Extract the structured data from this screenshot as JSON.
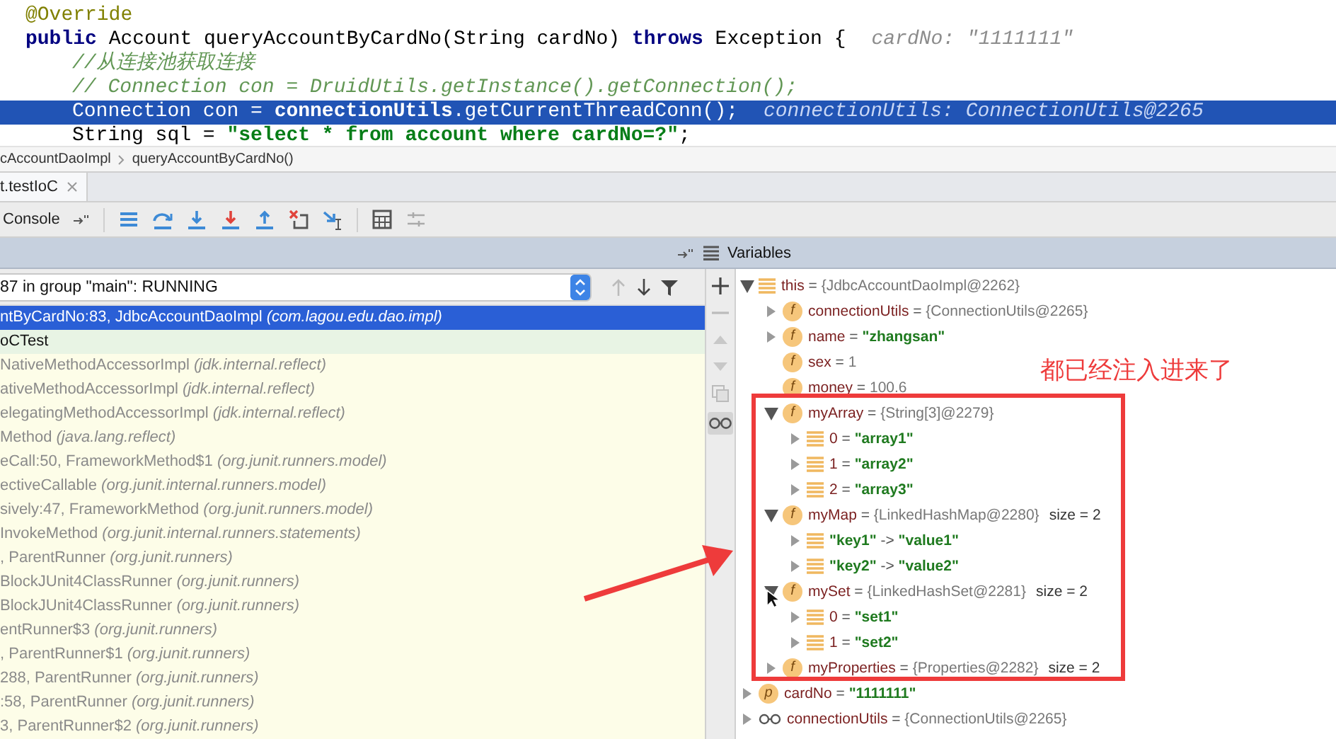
{
  "editor": {
    "lines": [
      {
        "indented": false,
        "selected": false,
        "tokens": [
          {
            "kind": "annotation",
            "text": "@Override"
          }
        ]
      },
      {
        "indented": false,
        "selected": false,
        "tokens": [
          {
            "kind": "keyword",
            "text": "public"
          },
          {
            "kind": "plain",
            "text": " Account queryAccountByCardNo(String cardNo) "
          },
          {
            "kind": "keyword",
            "text": "throws"
          },
          {
            "kind": "plain",
            "text": " Exception {"
          }
        ],
        "hint": "cardNo: \"1111111\""
      },
      {
        "indented": true,
        "selected": false,
        "tokens": [
          {
            "kind": "comment",
            "text": "//从连接池获取连接"
          }
        ]
      },
      {
        "indented": true,
        "selected": false,
        "tokens": [
          {
            "kind": "comment",
            "text": "// Connection con = DruidUtils.getInstance().getConnection();"
          }
        ]
      },
      {
        "indented": true,
        "selected": true,
        "tokens": [
          {
            "kind": "plain",
            "text": "Connection con = "
          },
          {
            "kind": "field",
            "text": "connectionUtils"
          },
          {
            "kind": "plain",
            "text": ".getCurrentThreadConn();"
          }
        ],
        "hint": "connectionUtils: ConnectionUtils@2265"
      },
      {
        "indented": true,
        "selected": false,
        "tokens": [
          {
            "kind": "plain",
            "text": "String sql = "
          },
          {
            "kind": "string",
            "text": "\"select * from account where cardNo=?\""
          },
          {
            "kind": "plain",
            "text": ";"
          }
        ]
      }
    ]
  },
  "breadcrumb": [
    "cAccountDaoImpl",
    "queryAccountByCardNo()"
  ],
  "tabs": [
    {
      "label": "t.testIoC",
      "selected": true
    }
  ],
  "console_tab": "Console",
  "variables_header": "Variables",
  "thread": {
    "value": "87 in group \"main\": RUNNING"
  },
  "frames": [
    {
      "method": "ntByCardNo:83, JdbcAccountDaoImpl ",
      "package": "(com.lagou.edu.dao.impl)",
      "selected": true,
      "kind": "project"
    },
    {
      "method": "oCTest",
      "selected": false,
      "kind": "project"
    },
    {
      "method": "NativeMethodAccessorImpl ",
      "package": "(jdk.internal.reflect)",
      "selected": false,
      "kind": "library"
    },
    {
      "method": "ativeMethodAccessorImpl ",
      "package": "(jdk.internal.reflect)",
      "selected": false,
      "kind": "library"
    },
    {
      "method": "elegatingMethodAccessorImpl ",
      "package": "(jdk.internal.reflect)",
      "selected": false,
      "kind": "library"
    },
    {
      "method": "Method ",
      "package": "(java.lang.reflect)",
      "selected": false,
      "kind": "library"
    },
    {
      "method": "eCall:50, FrameworkMethod$1 ",
      "package": "(org.junit.runners.model)",
      "selected": false,
      "kind": "library"
    },
    {
      "method": "ectiveCallable ",
      "package": "(org.junit.internal.runners.model)",
      "selected": false,
      "kind": "library"
    },
    {
      "method": "sively:47, FrameworkMethod ",
      "package": "(org.junit.runners.model)",
      "selected": false,
      "kind": "library"
    },
    {
      "method": "InvokeMethod ",
      "package": "(org.junit.internal.runners.statements)",
      "selected": false,
      "kind": "library"
    },
    {
      "method": ", ParentRunner ",
      "package": "(org.junit.runners)",
      "selected": false,
      "kind": "library"
    },
    {
      "method": "BlockJUnit4ClassRunner ",
      "package": "(org.junit.runners)",
      "selected": false,
      "kind": "library"
    },
    {
      "method": "BlockJUnit4ClassRunner ",
      "package": "(org.junit.runners)",
      "selected": false,
      "kind": "library"
    },
    {
      "method": "entRunner$3 ",
      "package": "(org.junit.runners)",
      "selected": false,
      "kind": "library"
    },
    {
      "method": ", ParentRunner$1 ",
      "package": "(org.junit.runners)",
      "selected": false,
      "kind": "library"
    },
    {
      "method": "288, ParentRunner ",
      "package": "(org.junit.runners)",
      "selected": false,
      "kind": "library"
    },
    {
      "method": ":58, ParentRunner ",
      "package": "(org.junit.runners)",
      "selected": false,
      "kind": "library"
    },
    {
      "method": "3, ParentRunner$2 ",
      "package": "(org.junit.runners)",
      "selected": false,
      "kind": "library"
    }
  ],
  "variables": [
    {
      "kind": "object",
      "name": "this",
      "separator": " = ",
      "value": "{JdbcAccountDaoImpl@2262}",
      "expandable": true,
      "expanded": true,
      "children": [
        {
          "kind": "field",
          "badge": "f",
          "name": "connectionUtils",
          "separator": " = ",
          "value": "{ConnectionUtils@2265}",
          "expandable": true,
          "expanded": false
        },
        {
          "kind": "field",
          "badge": "f",
          "name": "name",
          "separator": " = ",
          "value": "**\"zhangsan\"**",
          "expandable": true,
          "expanded": false
        },
        {
          "kind": "field",
          "badge": "f",
          "name": "sex",
          "separator": " = ",
          "value": "1",
          "expandable": false
        },
        {
          "kind": "field",
          "badge": "f",
          "name": "money",
          "separator": " = ",
          "value": "100.6",
          "expandable": false
        },
        {
          "kind": "field",
          "badge": "f",
          "name": "myArray",
          "separator": " = ",
          "value": "{String[3]@2279}",
          "expandable": true,
          "expanded": true,
          "children": [
            {
              "kind": "object",
              "name": "0",
              "separator": " = ",
              "value": "**\"array1\"**",
              "expandable": true,
              "expanded": false
            },
            {
              "kind": "object",
              "name": "1",
              "separator": " = ",
              "value": "**\"array2\"**",
              "expandable": true,
              "expanded": false
            },
            {
              "kind": "object",
              "name": "2",
              "separator": " = ",
              "value": "**\"array3\"**",
              "expandable": true,
              "expanded": false
            }
          ]
        },
        {
          "kind": "field",
          "badge": "f",
          "name": "myMap",
          "separator": " = ",
          "value": "{LinkedHashMap@2280}",
          "size": "size = 2",
          "expandable": true,
          "expanded": true,
          "children": [
            {
              "kind": "object",
              "name": "**\"key1\"**",
              "separator": " -> ",
              "value": "**\"value1\"**",
              "expandable": true,
              "expanded": false
            },
            {
              "kind": "object",
              "name": "**\"key2\"**",
              "separator": " -> ",
              "value": "**\"value2\"**",
              "expandable": true,
              "expanded": false
            }
          ]
        },
        {
          "kind": "field",
          "badge": "f",
          "name": "mySet",
          "separator": " = ",
          "value": "{LinkedHashSet@2281}",
          "size": "size = 2",
          "expandable": true,
          "expanded": true,
          "children": [
            {
              "kind": "object",
              "name": "0",
              "separator": " = ",
              "value": "**\"set1\"**",
              "expandable": true,
              "expanded": false
            },
            {
              "kind": "object",
              "name": "1",
              "separator": " = ",
              "value": "**\"set2\"**",
              "expandable": true,
              "expanded": false
            }
          ]
        },
        {
          "kind": "field",
          "badge": "f",
          "name": "myProperties",
          "separator": " = ",
          "value": "{Properties@2282}",
          "size": "size = 2",
          "expandable": true,
          "expanded": false
        }
      ]
    },
    {
      "kind": "field",
      "badge": "p",
      "name": "cardNo",
      "separator": " = ",
      "value": "**\"1111111\"**",
      "expandable": true,
      "expanded": false
    },
    {
      "kind": "watch",
      "name": "connectionUtils",
      "separator": " = ",
      "value": "{ConnectionUtils@2265}",
      "expandable": true,
      "expanded": false
    }
  ],
  "note": {
    "text": "都已经注入进来了"
  }
}
